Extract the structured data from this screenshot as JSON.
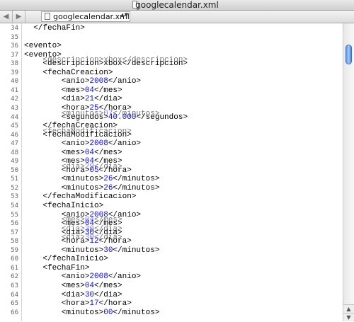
{
  "window": {
    "title": "googlecalendar.xml"
  },
  "navbar": {
    "back_glyph": "◀",
    "forward_glyph": "▶",
    "file_name": "googlecalendar.xml",
    "updown_glyph": "▲▼"
  },
  "scrollbar": {
    "up_glyph": "▲",
    "down_glyph": "▼"
  },
  "lines": [
    {
      "n": "34",
      "text": "  </fechaFin>"
    },
    {
      "n": "35",
      "text": ""
    },
    {
      "n": "36",
      "text": "<evento>"
    },
    {
      "n": "37",
      "text": "<evento>"
    },
    {
      "n": "38",
      "text": "    <descripcion>xbox</descripcion>"
    },
    {
      "n": "39",
      "text": "    <fechaCreacion>"
    },
    {
      "n": "40",
      "pre": "        <anio>",
      "val": "2008",
      "post": "</anio>"
    },
    {
      "n": "41",
      "pre": "        <mes>",
      "val": "04",
      "post": "</mes>"
    },
    {
      "n": "42",
      "pre": "        <dia>",
      "val": "21",
      "post": "</dia>"
    },
    {
      "n": "43",
      "pre": "        <hora>",
      "val": "25",
      "post": "</hora>"
    },
    {
      "n": "44",
      "pre": "        <segundos>",
      "val": "40.000",
      "post": "</segundos>"
    },
    {
      "n": "45",
      "text": "    </fechaCreacion>"
    },
    {
      "n": "46",
      "text": "    <fechaModificacion>"
    },
    {
      "n": "47",
      "pre": "        <anio>",
      "val": "2008",
      "post": "</anio>"
    },
    {
      "n": "48",
      "pre": "        <mes>",
      "val": "04",
      "post": "</mes>"
    },
    {
      "n": "49",
      "pre": "        <mes>",
      "val": "04",
      "post": "</mes>"
    },
    {
      "n": "50",
      "pre": "        <hora>",
      "val": "05",
      "post": "</hora>"
    },
    {
      "n": "51",
      "pre": "        <minutos>",
      "val": "26",
      "post": "</minutos>"
    },
    {
      "n": "52",
      "pre": "        <minutos>",
      "val": "26",
      "post": "</minutos>"
    },
    {
      "n": "53",
      "text": "    </fechaModificacion>"
    },
    {
      "n": "54",
      "text": "    <fechaInicio>"
    },
    {
      "n": "55",
      "pre": "        <anio>",
      "val": "2008",
      "post": "</anio>"
    },
    {
      "n": "56",
      "pre": "        <mes>",
      "val": "04",
      "post": "</mes>"
    },
    {
      "n": "57",
      "pre": "        <dia>",
      "val": "30",
      "post": "</dia>"
    },
    {
      "n": "58",
      "pre": "        <hora>",
      "val": "12",
      "post": "</hora>"
    },
    {
      "n": "59",
      "pre": "        <minutos>",
      "val": "30",
      "post": "</minutos>"
    },
    {
      "n": "60",
      "text": "    </fechaInicio>"
    },
    {
      "n": "61",
      "text": "    <fechaFin>"
    },
    {
      "n": "62",
      "pre": "        <anio>",
      "val": "2008",
      "post": "</anio>"
    },
    {
      "n": "63",
      "pre": "        <mes>",
      "val": "04",
      "post": "</mes>"
    },
    {
      "n": "64",
      "pre": "        <dia>",
      "val": "30",
      "post": "</dia>"
    },
    {
      "n": "65",
      "pre": "        <hora>",
      "val": "17",
      "post": "</hora>"
    },
    {
      "n": "66",
      "pre": "        <minutos>",
      "val": "00",
      "post": "</minutos>"
    }
  ],
  "ghost_lines": [
    {
      "row": 4,
      "text": "    <descripcion>xbox</descripcion>"
    },
    {
      "row": 10,
      "pre": "        <minutos>",
      "val": "07",
      "post": "</minutos>"
    },
    {
      "row": 12,
      "text": "    <fechaModificacion>"
    },
    {
      "row": 16,
      "pre": "        <dia>",
      "val": "29",
      "post": "</dia>"
    },
    {
      "row": 22,
      "pre": "        <mes>",
      "val": "04",
      "post": "</mes>"
    },
    {
      "row": 23,
      "pre": "        <dia>",
      "val": "30",
      "post": "</dia>"
    },
    {
      "row": 24,
      "pre": "        <dia>",
      "val": "30",
      "post": "</dia>"
    }
  ]
}
